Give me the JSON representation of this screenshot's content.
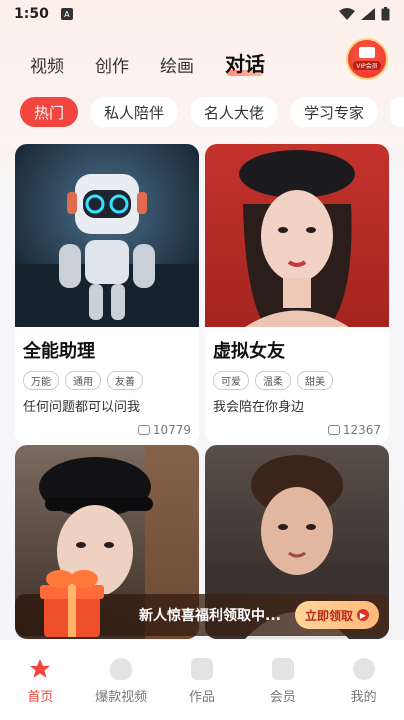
{
  "status_bar": {
    "time": "1:50",
    "badge": "A"
  },
  "top_tabs": [
    {
      "label": "视频"
    },
    {
      "label": "创作"
    },
    {
      "label": "绘画"
    },
    {
      "label": "对话"
    }
  ],
  "vip": {
    "label": "VIP会员"
  },
  "chips": [
    {
      "label": "热门"
    },
    {
      "label": "私人陪伴"
    },
    {
      "label": "名人大佬"
    },
    {
      "label": "学习专家"
    }
  ],
  "cards": [
    {
      "name": "全能助理",
      "tags": [
        "万能",
        "通用",
        "友善"
      ],
      "desc": "任何问题都可以问我",
      "count": "10779"
    },
    {
      "name": "虚拟女友",
      "tags": [
        "可爱",
        "温柔",
        "甜美"
      ],
      "desc": "我会陪在你身边",
      "count": "12367"
    }
  ],
  "promo": {
    "text": "新人惊喜福利领取中...",
    "cta": "立即领取"
  },
  "bottom_nav": [
    {
      "label": "首页"
    },
    {
      "label": "爆款视频"
    },
    {
      "label": "作品"
    },
    {
      "label": "会员"
    },
    {
      "label": "我的"
    }
  ],
  "colors": {
    "accent": "#f2453d",
    "background": "#f5f5f7"
  }
}
